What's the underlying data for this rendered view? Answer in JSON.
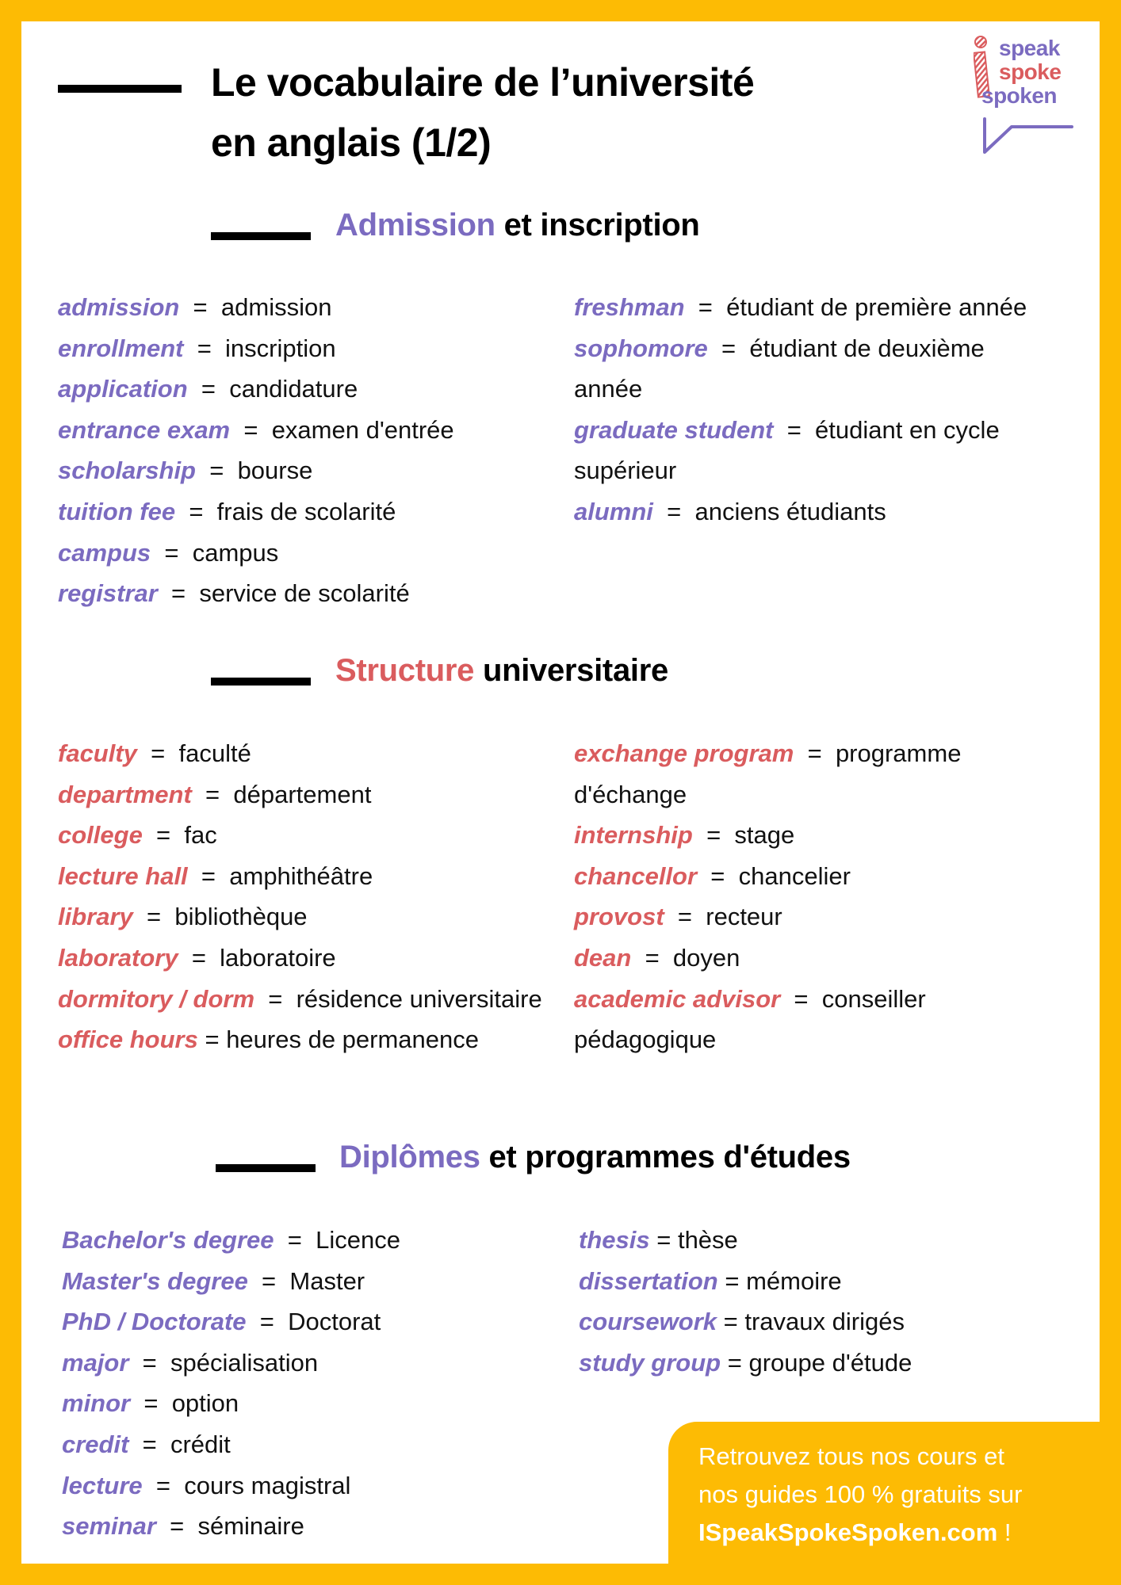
{
  "header": {
    "title_line1": "Le vocabulaire de l’université",
    "title_line2": "en anglais (1/2)"
  },
  "logo": {
    "words": [
      "speak",
      "spoke",
      "spoken"
    ],
    "icon": "i-letter-striped-icon",
    "bubble": "speech-bubble-tail-icon"
  },
  "colors": {
    "background": "#FDBB04",
    "purple": "#7B6BC0",
    "red": "#DA5C5E",
    "text": "#111111"
  },
  "sections": [
    {
      "title_highlight": "Admission",
      "title_rest": " et inscription",
      "left": [
        {
          "term": "admission",
          "sep": "  =  ",
          "def": "admission"
        },
        {
          "term": "enrollment",
          "sep": "  =  ",
          "def": "inscription"
        },
        {
          "term": "application",
          "sep": "  =  ",
          "def": "candidature"
        },
        {
          "term": "entrance exam",
          "sep": "  =  ",
          "def": "examen d'entrée"
        },
        {
          "term": "scholarship",
          "sep": "  =  ",
          "def": "bourse"
        },
        {
          "term": "tuition fee",
          "sep": "  =  ",
          "def": "frais de scolarité"
        },
        {
          "term": "campus",
          "sep": "  =  ",
          "def": "campus"
        },
        {
          "term": "registrar",
          "sep": "  =  ",
          "def": "service de scolarité"
        }
      ],
      "right": [
        {
          "term": "freshman",
          "sep": "  =  ",
          "def": "étudiant de première année"
        },
        {
          "term": "sophomore",
          "sep": "  =  ",
          "def": "étudiant de deuxième année"
        },
        {
          "term": "graduate student",
          "sep": "  =  ",
          "def": "étudiant en cycle supérieur"
        },
        {
          "term": "alumni",
          "sep": "  =  ",
          "def": "anciens étudiants"
        }
      ]
    },
    {
      "title_highlight": "Structure",
      "title_rest": " universitaire",
      "left": [
        {
          "term": "faculty",
          "sep": "  =  ",
          "def": "faculté"
        },
        {
          "term": "department",
          "sep": "  =  ",
          "def": "département"
        },
        {
          "term": "college",
          "sep": "  =  ",
          "def": "fac"
        },
        {
          "term": "lecture hall",
          "sep": "  =  ",
          "def": "amphithéâtre"
        },
        {
          "term": "library",
          "sep": "  =  ",
          "def": "bibliothèque"
        },
        {
          "term": "laboratory",
          "sep": "  =  ",
          "def": "laboratoire"
        },
        {
          "term": "dormitory / dorm",
          "sep": "  =  ",
          "def": "résidence universitaire"
        },
        {
          "term": "office hours",
          "sep": " = ",
          "def": "heures de permanence"
        }
      ],
      "right": [
        {
          "term": "exchange program",
          "sep": "  =  ",
          "def": "programme d'échange"
        },
        {
          "term": "internship",
          "sep": "  =  ",
          "def": "stage"
        },
        {
          "term": "chancellor",
          "sep": "  =  ",
          "def": "chancelier"
        },
        {
          "term": "provost",
          "sep": "  =  ",
          "def": "recteur"
        },
        {
          "term": "dean",
          "sep": "  =  ",
          "def": "doyen"
        },
        {
          "term": "academic advisor",
          "sep": "  =  ",
          "def": "conseiller pédagogique"
        }
      ]
    },
    {
      "title_highlight": "Diplômes",
      "title_rest": " et programmes d'études",
      "left": [
        {
          "term": "Bachelor's degree",
          "sep": "  =  ",
          "def": "Licence"
        },
        {
          "term": "Master's degree",
          "sep": "  =  ",
          "def": "Master"
        },
        {
          "term": "PhD / Doctorate",
          "sep": "  =  ",
          "def": "Doctorat"
        },
        {
          "term": "major",
          "sep": "  =  ",
          "def": "spécialisation"
        },
        {
          "term": "minor",
          "sep": "  =  ",
          "def": "option"
        },
        {
          "term": "credit",
          "sep": "  =  ",
          "def": "crédit"
        },
        {
          "term": "lecture",
          "sep": "  =  ",
          "def": "cours magistral"
        },
        {
          "term": "seminar",
          "sep": "  =  ",
          "def": "séminaire"
        }
      ],
      "right": [
        {
          "term": "thesis",
          "sep": " = ",
          "def": "thèse"
        },
        {
          "term": "dissertation",
          "sep": " = ",
          "def": "mémoire"
        },
        {
          "term": "coursework",
          "sep": " = ",
          "def": "travaux dirigés"
        },
        {
          "term": "study group",
          "sep": " = ",
          "def": "groupe d'étude"
        }
      ]
    }
  ],
  "promo": {
    "line1": "Retrouvez tous nos cours et",
    "line2": "nos guides 100 % gratuits sur",
    "link": "ISpeakSpokeSpoken.com",
    "suffix": " !"
  }
}
